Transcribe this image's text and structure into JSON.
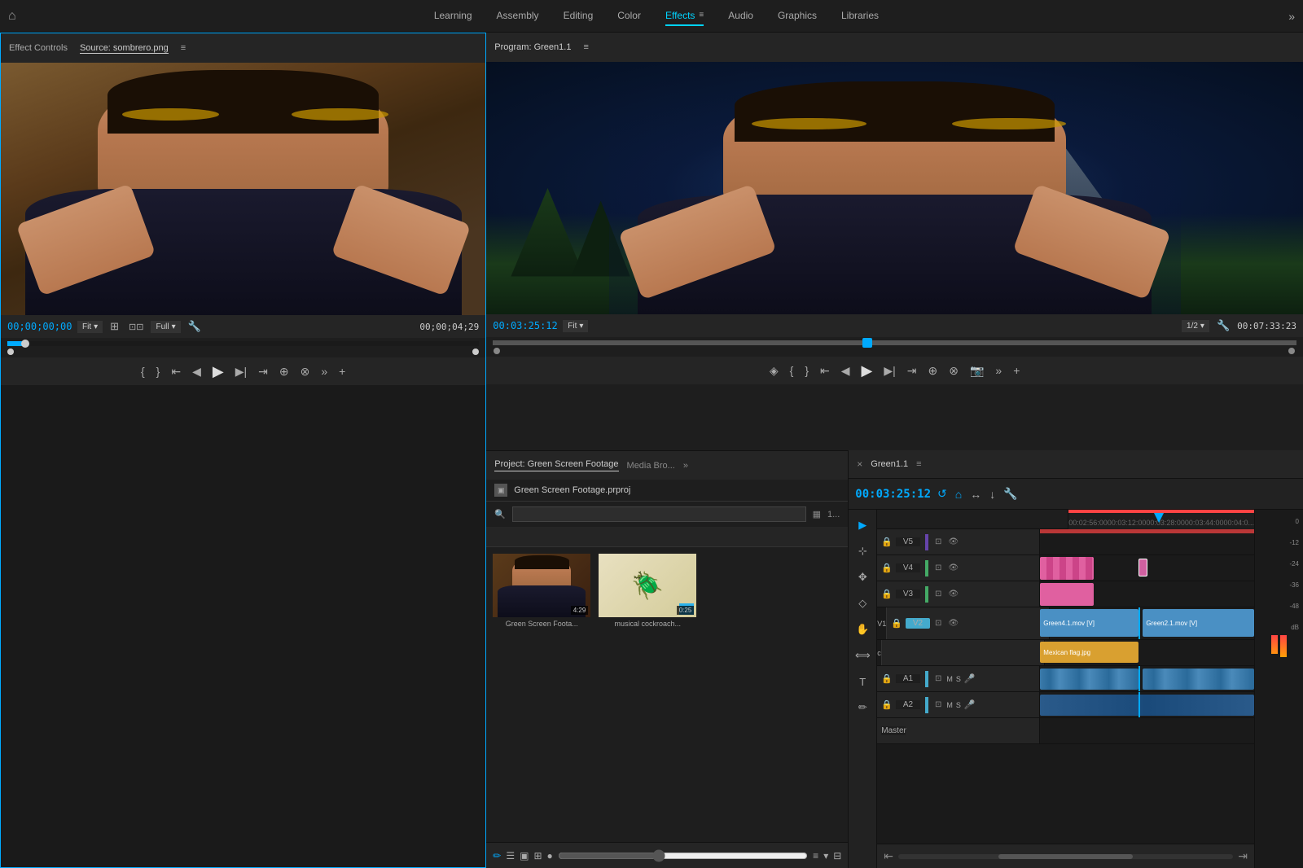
{
  "nav": {
    "home_icon": "⌂",
    "items": [
      {
        "label": "Learning",
        "active": false
      },
      {
        "label": "Assembly",
        "active": false
      },
      {
        "label": "Editing",
        "active": false
      },
      {
        "label": "Color",
        "active": false
      },
      {
        "label": "Effects",
        "active": true
      },
      {
        "label": "Audio",
        "active": false
      },
      {
        "label": "Graphics",
        "active": false
      },
      {
        "label": "Libraries",
        "active": false
      }
    ],
    "more": "»"
  },
  "source_monitor": {
    "tab1": "Effect Controls",
    "tab2": "Source: sombrero.png",
    "menu_icon": "≡",
    "timecode": "00;00;00;00",
    "fit_label": "Fit",
    "full_label": "Full",
    "duration": "00;00;04;29"
  },
  "program_monitor": {
    "title": "Program: Green1.1",
    "menu_icon": "≡",
    "timecode": "00:03:25:12",
    "fit_label": "Fit",
    "quality": "1/2",
    "duration": "00:07:33:23"
  },
  "project_panel": {
    "tab1": "Project: Green Screen Footage",
    "tab2": "Media Bro...",
    "menu_icon": "≡",
    "expand_icon": "»",
    "file_name": "Green Screen Footage.prproj",
    "search_placeholder": "",
    "thumbs": [
      {
        "label": "Green Screen Foota...",
        "duration": "4:29",
        "type": "person"
      },
      {
        "label": "musical cockroach...",
        "duration": "0:25",
        "type": "cockroach"
      }
    ],
    "bottom_icons": [
      "✏",
      "☰",
      "▣",
      "⊞",
      "●"
    ]
  },
  "timeline": {
    "tab": "Green1.1",
    "menu_icon": "≡",
    "close_icon": "×",
    "timecode": "00:03:25:12",
    "controls": [
      "↺",
      "⌂",
      "→",
      "↓",
      "🔧"
    ],
    "tracks": [
      {
        "name": "V5",
        "type": "video",
        "locked": true
      },
      {
        "name": "V4",
        "type": "video",
        "locked": true
      },
      {
        "name": "V3",
        "type": "video",
        "locked": true
      },
      {
        "name": "V2",
        "type": "video",
        "locked": false,
        "label": "V1"
      },
      {
        "name": "A1",
        "type": "audio",
        "locked": true
      },
      {
        "name": "A2",
        "type": "audio",
        "locked": true
      },
      {
        "name": "Master",
        "type": "master"
      }
    ],
    "ruler_marks": [
      "00:02:56:00",
      "00:03:12:00",
      "00:03:28:00",
      "00:03:44:00",
      "00:04:0..."
    ],
    "clips": [
      {
        "track": "V2",
        "label": "Green4.1.mov [V]",
        "type": "blue"
      },
      {
        "track": "V2",
        "label": "Green2.1.mov [V]",
        "type": "blue"
      },
      {
        "track": "V1",
        "label": "Mexican flag.jpg",
        "type": "pink"
      }
    ],
    "audio_meter_labels": [
      "0",
      "-12",
      "-24",
      "-36",
      "-48",
      "dB"
    ]
  }
}
